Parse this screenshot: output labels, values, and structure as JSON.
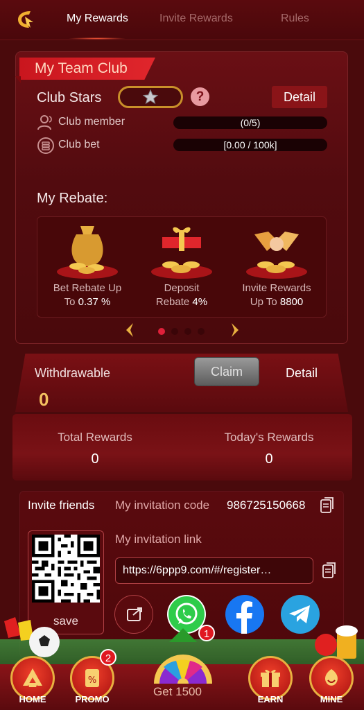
{
  "nav": {
    "tabs": [
      {
        "label": "My Rewards",
        "active": true
      },
      {
        "label": "Invite Rewards",
        "active": false
      },
      {
        "label": "Rules",
        "active": false
      }
    ]
  },
  "club": {
    "title": "My Team Club",
    "stars_label": "Club Stars",
    "detail_label": "Detail",
    "rows": [
      {
        "icon": "person-icon",
        "label": "Club member",
        "progress": "(0/5)"
      },
      {
        "icon": "coin-stack-icon",
        "label": "Club bet",
        "progress": "[0.00 / 100k]"
      }
    ]
  },
  "rebate": {
    "title": "My Rebate:",
    "items": [
      {
        "line1": "Bet Rebate Up",
        "line2_prefix": "To ",
        "line2_value": "0.37 %"
      },
      {
        "line1": "Deposit",
        "line2_prefix": "Rebate ",
        "line2_value": "4%"
      },
      {
        "line1": "Invite Rewards",
        "line2_prefix": "Up To ",
        "line2_value": "8800"
      }
    ],
    "page_index": 0,
    "page_count": 4
  },
  "withdraw": {
    "label": "Withdrawable",
    "amount": "0",
    "claim_label": "Claim",
    "detail_label": "Detail"
  },
  "summary": {
    "total_label": "Total Rewards",
    "total_value": "0",
    "today_label": "Today's Rewards",
    "today_value": "0"
  },
  "invite": {
    "title": "Invite friends",
    "code_label": "My invitation code",
    "code": "986725150668",
    "link_label": "My invitation link",
    "link": "https://6ppp9.com/#/register…",
    "save_label": "save"
  },
  "bottom_nav": {
    "items": [
      {
        "label": "HOME"
      },
      {
        "label": "PROMO",
        "badge": "2"
      },
      {
        "label": "EARN"
      },
      {
        "label": "MINE"
      }
    ],
    "center_label": "Get 1500",
    "center_badge": "1"
  },
  "colors": {
    "background": "#4a0a0c",
    "accent_red": "#e0262c",
    "gold": "#e8b040"
  }
}
